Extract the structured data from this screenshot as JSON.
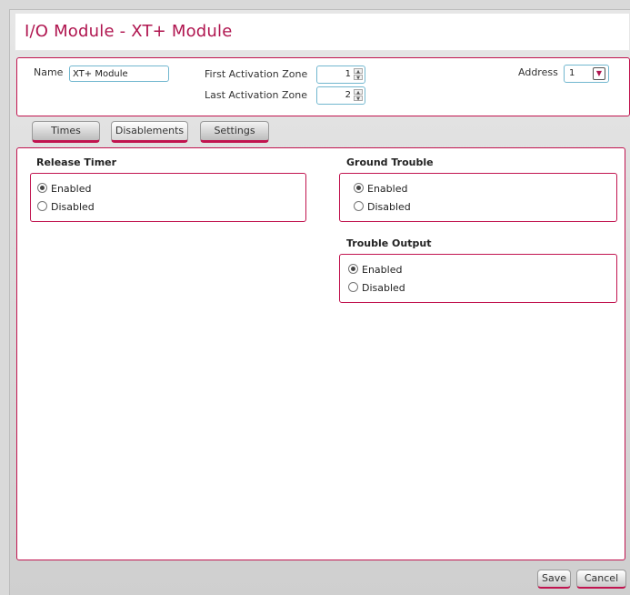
{
  "window": {
    "title": "I/O Module - XT+ Module"
  },
  "props": {
    "name_label": "Name",
    "name_value": "XT+ Module",
    "first_zone_label": "First Activation Zone",
    "first_zone_value": "1",
    "last_zone_label": "Last Activation Zone",
    "last_zone_value": "2",
    "address_label": "Address",
    "address_value": "1"
  },
  "tabs": [
    {
      "label": "Times"
    },
    {
      "label": "Disablements",
      "active": true
    },
    {
      "label": "Settings"
    }
  ],
  "release_timer": {
    "title": "Release Timer",
    "options": [
      "Enabled",
      "Disabled"
    ],
    "selected": "Enabled"
  },
  "ground_trouble": {
    "title": "Ground Trouble",
    "options": [
      "Enabled",
      "Disabled"
    ],
    "selected": "Enabled"
  },
  "trouble_output": {
    "title": "Trouble Output",
    "options": [
      "Enabled",
      "Disabled"
    ],
    "selected": "Enabled"
  },
  "footer": {
    "save_label": "Save",
    "cancel_label": "Cancel"
  },
  "colors": {
    "accent": "#c1144f",
    "title": "#b0154f",
    "field_border": "#72b7cf"
  },
  "icons": {
    "spin_up": "spin-up-arrow",
    "spin_down": "spin-down-arrow",
    "dropdown": "dropdown-arrow"
  }
}
